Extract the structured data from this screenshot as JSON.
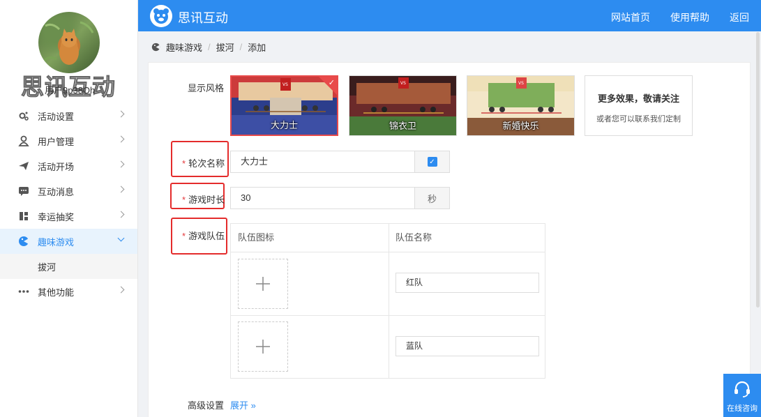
{
  "app": {
    "title": "思讯互动"
  },
  "topnav": {
    "home": "网站首页",
    "help": "使用帮助",
    "back": "返回"
  },
  "sidebar": {
    "brand_watermark": "思讯互动",
    "username": "用户9p38Oh",
    "items": [
      {
        "label": "活动设置",
        "icon": "gear-icon"
      },
      {
        "label": "用户管理",
        "icon": "user-icon"
      },
      {
        "label": "活动开场",
        "icon": "paper-plane-icon"
      },
      {
        "label": "互动消息",
        "icon": "message-icon"
      },
      {
        "label": "幸运抽奖",
        "icon": "gift-icon"
      },
      {
        "label": "趣味游戏",
        "icon": "game-icon",
        "active": true
      },
      {
        "label": "其他功能",
        "icon": "more-icon"
      }
    ],
    "submenu": {
      "label": "拔河"
    }
  },
  "breadcrumb": {
    "root": "趣味游戏",
    "mid": "拔河",
    "current": "添加"
  },
  "form": {
    "style_label": "显示风格",
    "styles": [
      {
        "name": "大力士",
        "selected": true
      },
      {
        "name": "锦衣卫",
        "selected": false
      },
      {
        "name": "新婚快乐",
        "selected": false
      }
    ],
    "more": {
      "title": "更多效果，敬请关注",
      "subtitle": "或者您可以联系我们定制"
    },
    "round_name_label": "轮次名称",
    "round_name_value": "大力士",
    "round_name_checked": true,
    "duration_label": "游戏时长",
    "duration_value": "30",
    "duration_unit": "秒",
    "teams_label": "游戏队伍",
    "teams_table": {
      "col_icon": "队伍图标",
      "col_name": "队伍名称",
      "rows": [
        {
          "name": "红队"
        },
        {
          "name": "蓝队"
        }
      ]
    },
    "advanced_label": "高级设置",
    "advanced_link": "展开 »"
  },
  "online": {
    "label": "在线咨询"
  },
  "colors": {
    "primary": "#2d8cf0",
    "danger": "#e42b2b"
  }
}
